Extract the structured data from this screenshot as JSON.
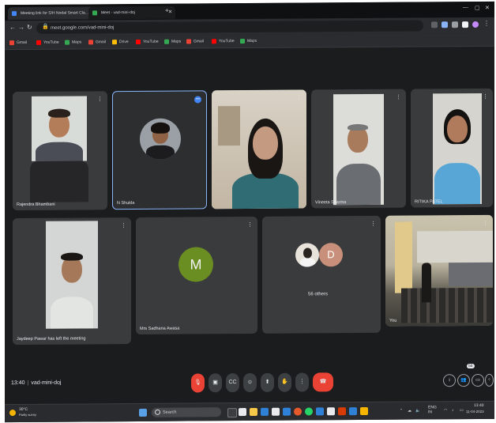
{
  "browser": {
    "tabs": [
      {
        "title": "Meeting link for S/H Nodal Smart Cla...",
        "favicon": "#4285f4"
      },
      {
        "title": "Meet - vad-mini-doj",
        "favicon": "#34a853"
      }
    ],
    "new_tab": "+",
    "url": "meet.google.com/vad-mini-doj",
    "bookmarks": [
      {
        "label": "Gmail",
        "color": "#ea4335"
      },
      {
        "label": "YouTube",
        "color": "#ff0000"
      },
      {
        "label": "Maps",
        "color": "#34a853"
      },
      {
        "label": "Gmail",
        "color": "#ea4335"
      },
      {
        "label": "Drive",
        "color": "#fbbc04"
      },
      {
        "label": "YouTube",
        "color": "#ff0000"
      },
      {
        "label": "Maps",
        "color": "#34a853"
      },
      {
        "label": "Gmail",
        "color": "#ea4335"
      },
      {
        "label": "YouTube",
        "color": "#ff0000"
      },
      {
        "label": "Maps",
        "color": "#34a853"
      }
    ]
  },
  "meeting": {
    "participants": [
      {
        "name": "Rajendra Bhambani"
      },
      {
        "name": "N Shukla"
      },
      {
        "name": ""
      },
      {
        "name": "Vineeta Sharma"
      },
      {
        "name": "RITIKA PATEL"
      },
      {
        "name": "Jaydeep Pawar has left the meeting"
      },
      {
        "name": "Mrs Sadhana Awasa",
        "initial": "M",
        "avatar_color": "#6b8e23"
      },
      {
        "name": "56 others",
        "initial": "D"
      },
      {
        "name": "You"
      }
    ],
    "time": "13:40",
    "code": "vad-mini-doj",
    "chat_badge": "56"
  },
  "taskbar": {
    "weather_temp": "30°C",
    "weather_desc": "Partly sunny",
    "search_placeholder": "Search",
    "language": "ENG\nIN",
    "clock_time": "13:40",
    "clock_date": "11-04-2023"
  }
}
